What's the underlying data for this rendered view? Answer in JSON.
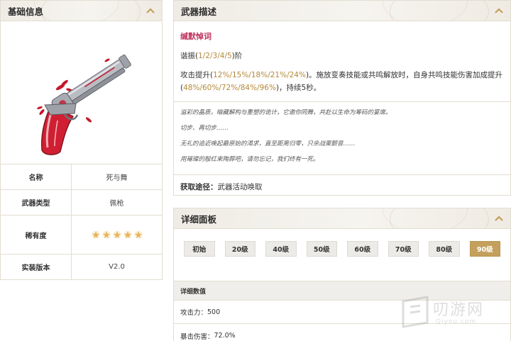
{
  "basic_info": {
    "title": "基础信息",
    "rows": [
      {
        "key": "名称",
        "value": "死与舞"
      },
      {
        "key": "武器类型",
        "value": "佩枪"
      },
      {
        "key": "稀有度",
        "stars": 5
      },
      {
        "key": "实装版本",
        "value": "V2.0"
      }
    ]
  },
  "weapon_desc": {
    "title": "武器描述",
    "skill_name": "缄默悼词",
    "rank_prefix": "谐振(",
    "rank_values": "1/2/3/4/5",
    "rank_suffix": ")阶",
    "effect_prefix": "攻击提升(",
    "effect_values_1": "12%/15%/18%/21%/24%",
    "effect_mid": ")。施放变奏技能或共鸣解放时，自身共鸣技能伤害加成提升(",
    "effect_values_2": "48%/60%/72%/84%/96%",
    "effect_suffix": ")，持续5秒。",
    "lore": [
      "溢彩的晶质，暗藏解构与重塑的诡计，它邀你同舞，共赴以生命为筹码的宴席。",
      "切步、再切步……",
      "无礼的追近唤起最原始的渴求，直至距离归零，只余战栗颤音……",
      "用璀璨的殷红来陶葬吧，请勿忘记，我们终有一死。"
    ],
    "source_label": "获取途径：",
    "source_value": "武器活动唤取"
  },
  "detail": {
    "title": "详细面板",
    "levels": [
      "初始",
      "20级",
      "40级",
      "50级",
      "60级",
      "70级",
      "80级",
      "90级"
    ],
    "active_level": "90级",
    "values_title": "详细数值",
    "stats": [
      {
        "label": "攻击力：",
        "value": "500"
      },
      {
        "label": "暴击伤害：",
        "value": "72.0%"
      }
    ]
  },
  "watermark": {
    "text": "叨游网",
    "sub": "Qiyou.com"
  },
  "colors": {
    "accent_gold": "#c4a05c",
    "skill_pink": "#c0355f",
    "value_gold": "#b58a3a"
  }
}
